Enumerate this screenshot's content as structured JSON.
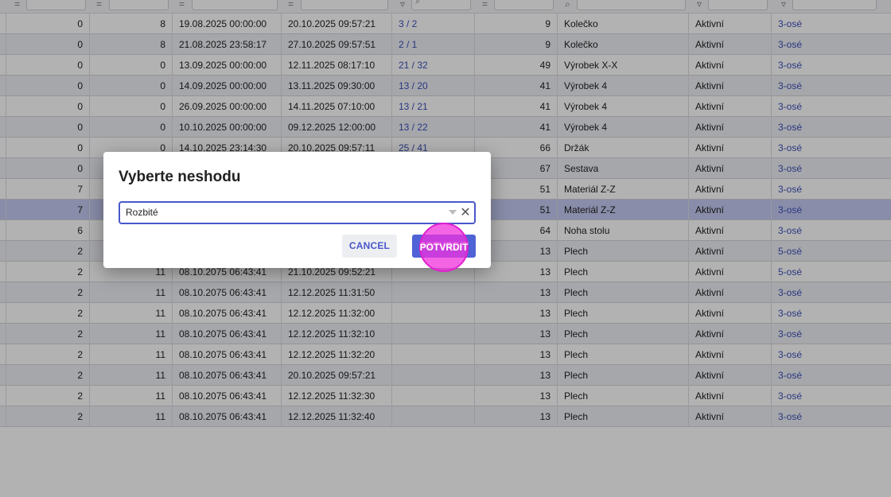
{
  "table": {
    "rows": [
      {
        "c1": "0",
        "c2": "8",
        "c3": "19.08.2025 00:00:00",
        "c4": "20.10.2025 09:57:21",
        "c5": "3 / 2",
        "c6": "9",
        "c7": "Kolečko",
        "c8": "Aktivní",
        "c9": "3-osé"
      },
      {
        "c1": "0",
        "c2": "8",
        "c3": "21.08.2025 23:58:17",
        "c4": "27.10.2025 09:57:51",
        "c5": "2 / 1",
        "c6": "9",
        "c7": "Kolečko",
        "c8": "Aktivní",
        "c9": "3-osé"
      },
      {
        "c1": "0",
        "c2": "0",
        "c3": "13.09.2025 00:00:00",
        "c4": "12.11.2025 08:17:10",
        "c5": "21 / 32",
        "c6": "49",
        "c7": "Výrobek X-X",
        "c8": "Aktivní",
        "c9": "3-osé"
      },
      {
        "c1": "0",
        "c2": "0",
        "c3": "14.09.2025 00:00:00",
        "c4": "13.11.2025 09:30:00",
        "c5": "13 / 20",
        "c6": "41",
        "c7": "Výrobek 4",
        "c8": "Aktivní",
        "c9": "3-osé"
      },
      {
        "c1": "0",
        "c2": "0",
        "c3": "26.09.2025 00:00:00",
        "c4": "14.11.2025 07:10:00",
        "c5": "13 / 21",
        "c6": "41",
        "c7": "Výrobek 4",
        "c8": "Aktivní",
        "c9": "3-osé"
      },
      {
        "c1": "0",
        "c2": "0",
        "c3": "10.10.2025 00:00:00",
        "c4": "09.12.2025 12:00:00",
        "c5": "13 / 22",
        "c6": "41",
        "c7": "Výrobek 4",
        "c8": "Aktivní",
        "c9": "3-osé"
      },
      {
        "c1": "0",
        "c2": "0",
        "c3": "14.10.2025 23:14:30",
        "c4": "20.10.2025 09:57:11",
        "c5": "25 / 41",
        "c6": "66",
        "c7": "Držák",
        "c8": "Aktivní",
        "c9": "3-osé"
      },
      {
        "c1": "0",
        "c2": "",
        "c3": "",
        "c4": "",
        "c5": "",
        "c6": "67",
        "c7": "Sestava",
        "c8": "Aktivní",
        "c9": "3-osé"
      },
      {
        "c1": "7",
        "c2": "",
        "c3": "",
        "c4": "",
        "c5": "",
        "c6": "51",
        "c7": "Materiál Z-Z",
        "c8": "Aktivní",
        "c9": "3-osé"
      },
      {
        "c1": "7",
        "c2": "",
        "c3": "",
        "c4": "",
        "c5": "",
        "c6": "51",
        "c7": "Materiál Z-Z",
        "c8": "Aktivní",
        "c9": "3-osé"
      },
      {
        "c1": "6",
        "c2": "",
        "c3": "",
        "c4": "",
        "c5": "",
        "c6": "64",
        "c7": "Noha stolu",
        "c8": "Aktivní",
        "c9": "3-osé"
      },
      {
        "c1": "2",
        "c2": "",
        "c3": "",
        "c4": "",
        "c5": "",
        "c6": "13",
        "c7": "Plech",
        "c8": "Aktivní",
        "c9": "5-osé"
      },
      {
        "c1": "2",
        "c2": "11",
        "c3": "08.10.2075 06:43:41",
        "c4": "21.10.2025 09:52:21",
        "c5": "",
        "c6": "13",
        "c7": "Plech",
        "c8": "Aktivní",
        "c9": "5-osé"
      },
      {
        "c1": "2",
        "c2": "11",
        "c3": "08.10.2075 06:43:41",
        "c4": "12.12.2025 11:31:50",
        "c5": "",
        "c6": "13",
        "c7": "Plech",
        "c8": "Aktivní",
        "c9": "3-osé"
      },
      {
        "c1": "2",
        "c2": "11",
        "c3": "08.10.2075 06:43:41",
        "c4": "12.12.2025 11:32:00",
        "c5": "",
        "c6": "13",
        "c7": "Plech",
        "c8": "Aktivní",
        "c9": "3-osé"
      },
      {
        "c1": "2",
        "c2": "11",
        "c3": "08.10.2075 06:43:41",
        "c4": "12.12.2025 11:32:10",
        "c5": "",
        "c6": "13",
        "c7": "Plech",
        "c8": "Aktivní",
        "c9": "3-osé"
      },
      {
        "c1": "2",
        "c2": "11",
        "c3": "08.10.2075 06:43:41",
        "c4": "12.12.2025 11:32:20",
        "c5": "",
        "c6": "13",
        "c7": "Plech",
        "c8": "Aktivní",
        "c9": "3-osé"
      },
      {
        "c1": "2",
        "c2": "11",
        "c3": "08.10.2075 06:43:41",
        "c4": "20.10.2025 09:57:21",
        "c5": "",
        "c6": "13",
        "c7": "Plech",
        "c8": "Aktivní",
        "c9": "3-osé"
      },
      {
        "c1": "2",
        "c2": "11",
        "c3": "08.10.2075 06:43:41",
        "c4": "12.12.2025 11:32:30",
        "c5": "",
        "c6": "13",
        "c7": "Plech",
        "c8": "Aktivní",
        "c9": "3-osé"
      },
      {
        "c1": "2",
        "c2": "11",
        "c3": "08.10.2075 06:43:41",
        "c4": "12.12.2025 11:32:40",
        "c5": "",
        "c6": "13",
        "c7": "Plech",
        "c8": "Aktivní",
        "c9": "3-osé"
      }
    ],
    "selected_row_index": 9
  },
  "dialog": {
    "title": "Vyberte neshodu",
    "select_value": "Rozbité",
    "clear_symbol": "✕",
    "cancel_label": "CANCEL",
    "confirm_label": "POTVRDIT"
  },
  "icons": {
    "filter_equals": "equals-icon",
    "filter_search": "search-icon",
    "filter_funnel": "funnel-icon",
    "select_caret": "caret-down-icon",
    "select_clear": "close-icon"
  },
  "colors": {
    "accent": "#4f62d6",
    "link": "#3b4fb8",
    "selected_row": "#c5cbf2",
    "touch_highlight": "#f032dc"
  }
}
